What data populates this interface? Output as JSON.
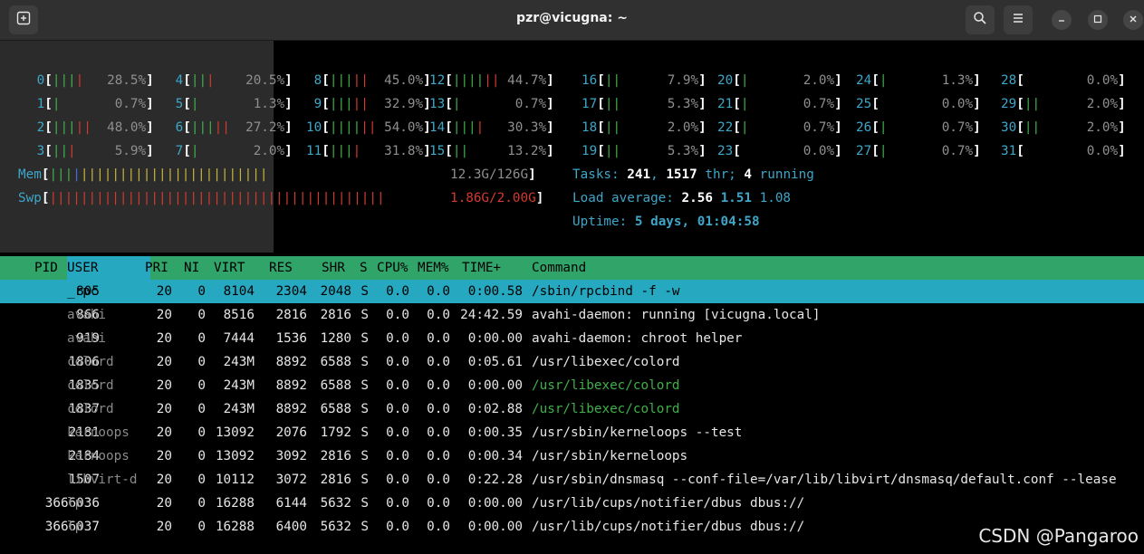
{
  "window": {
    "title": "pzr@vicugna: ~",
    "new_tab_icon": "new-tab-icon",
    "search_icon": "search-icon",
    "menu_icon": "hamburger-menu-icon",
    "minimize_icon": "minimize-icon",
    "maximize_icon": "maximize-icon",
    "close_icon": "close-icon"
  },
  "cpus": [
    {
      "id": "0",
      "bar": "||||",
      "pct": "28.5%"
    },
    {
      "id": "1",
      "bar": "|",
      "pct": "0.7%"
    },
    {
      "id": "2",
      "bar": "|||||",
      "pct": "48.0%"
    },
    {
      "id": "3",
      "bar": "|||",
      "pct": "5.9%"
    },
    {
      "id": "4",
      "bar": "|||",
      "pct": "20.5%"
    },
    {
      "id": "5",
      "bar": "|",
      "pct": "1.3%"
    },
    {
      "id": "6",
      "bar": "|||||",
      "pct": "27.2%"
    },
    {
      "id": "7",
      "bar": "|",
      "pct": "2.0%"
    },
    {
      "id": "8",
      "bar": "|||||",
      "pct": "45.0%"
    },
    {
      "id": "9",
      "bar": "|||||",
      "pct": "32.9%"
    },
    {
      "id": "10",
      "bar": "||||||",
      "pct": "54.0%"
    },
    {
      "id": "11",
      "bar": "||||",
      "pct": "31.8%"
    },
    {
      "id": "12",
      "bar": "||||||",
      "pct": "44.7%"
    },
    {
      "id": "13",
      "bar": "|",
      "pct": "0.7%"
    },
    {
      "id": "14",
      "bar": "||||",
      "pct": "30.3%"
    },
    {
      "id": "15",
      "bar": "||",
      "pct": "13.2%"
    },
    {
      "id": "16",
      "bar": "||",
      "pct": "7.9%"
    },
    {
      "id": "17",
      "bar": "||",
      "pct": "5.3%"
    },
    {
      "id": "18",
      "bar": "||",
      "pct": "2.0%"
    },
    {
      "id": "19",
      "bar": "||",
      "pct": "5.3%"
    },
    {
      "id": "20",
      "bar": "|",
      "pct": "2.0%"
    },
    {
      "id": "21",
      "bar": "|",
      "pct": "0.7%"
    },
    {
      "id": "22",
      "bar": "|",
      "pct": "0.7%"
    },
    {
      "id": "23",
      "bar": "",
      "pct": "0.0%"
    },
    {
      "id": "24",
      "bar": "|",
      "pct": "1.3%"
    },
    {
      "id": "25",
      "bar": "",
      "pct": "0.0%"
    },
    {
      "id": "26",
      "bar": "|",
      "pct": "0.7%"
    },
    {
      "id": "27",
      "bar": "|",
      "pct": "0.7%"
    },
    {
      "id": "28",
      "bar": "",
      "pct": "0.0%"
    },
    {
      "id": "29",
      "bar": "||",
      "pct": "2.0%"
    },
    {
      "id": "30",
      "bar": "||",
      "pct": "2.0%"
    },
    {
      "id": "31",
      "bar": "",
      "pct": "0.0%"
    }
  ],
  "mem": {
    "label": "Mem",
    "value": "12.3G/126G",
    "fill": 0.098
  },
  "swp": {
    "label": "Swp",
    "value": "1.86G/2.00G",
    "fill": 0.93
  },
  "tasks": {
    "label": "Tasks:",
    "count": "241",
    "thr": "1517",
    "thr_label": "thr;",
    "running": "4",
    "running_label": "running"
  },
  "load": {
    "label": "Load average:",
    "l1": "2.56",
    "l5": "1.51",
    "l15": "1.08"
  },
  "uptime": {
    "label": "Uptime:",
    "value": "5 days, 01:04:58"
  },
  "columns": [
    "PID",
    "USER",
    "PRI",
    "NI",
    "VIRT",
    "RES",
    "SHR",
    "S",
    "CPU%",
    "MEM%",
    "TIME+",
    "Command"
  ],
  "processes": [
    {
      "pid": "805",
      "user": "_rpc",
      "pri": "20",
      "ni": "0",
      "virt": "8104",
      "res": "2304",
      "shr": "2048",
      "s": "S",
      "cpu": "0.0",
      "mem": "0.0",
      "time": "0:00.58",
      "cmd": "/sbin/rpcbind -f -w"
    },
    {
      "pid": "866",
      "user": "avahi",
      "pri": "20",
      "ni": "0",
      "virt": "8516",
      "res": "2816",
      "shr": "2816",
      "s": "S",
      "cpu": "0.0",
      "mem": "0.0",
      "time": "24:42.59",
      "cmd": "avahi-daemon: running [vicugna.local]"
    },
    {
      "pid": "919",
      "user": "avahi",
      "pri": "20",
      "ni": "0",
      "virt": "7444",
      "res": "1536",
      "shr": "1280",
      "s": "S",
      "cpu": "0.0",
      "mem": "0.0",
      "time": "0:00.00",
      "cmd": "avahi-daemon: chroot helper"
    },
    {
      "pid": "1806",
      "user": "colord",
      "pri": "20",
      "ni": "0",
      "virt": "243M",
      "res": "8892",
      "shr": "6588",
      "s": "S",
      "cpu": "0.0",
      "mem": "0.0",
      "time": "0:05.61",
      "cmd": "/usr/libexec/colord"
    },
    {
      "pid": "1835",
      "user": "colord",
      "pri": "20",
      "ni": "0",
      "virt": "243M",
      "res": "8892",
      "shr": "6588",
      "s": "S",
      "cpu": "0.0",
      "mem": "0.0",
      "time": "0:00.00",
      "cmd": "/usr/libexec/colord"
    },
    {
      "pid": "1837",
      "user": "colord",
      "pri": "20",
      "ni": "0",
      "virt": "243M",
      "res": "8892",
      "shr": "6588",
      "s": "S",
      "cpu": "0.0",
      "mem": "0.0",
      "time": "0:02.88",
      "cmd": "/usr/libexec/colord"
    },
    {
      "pid": "2181",
      "user": "kernoops",
      "pri": "20",
      "ni": "0",
      "virt": "13092",
      "res": "2076",
      "shr": "1792",
      "s": "S",
      "cpu": "0.0",
      "mem": "0.0",
      "time": "0:00.35",
      "cmd": "/usr/sbin/kerneloops --test"
    },
    {
      "pid": "2184",
      "user": "kernoops",
      "pri": "20",
      "ni": "0",
      "virt": "13092",
      "res": "3092",
      "shr": "2816",
      "s": "S",
      "cpu": "0.0",
      "mem": "0.0",
      "time": "0:00.34",
      "cmd": "/usr/sbin/kerneloops"
    },
    {
      "pid": "1507",
      "user": "libvirt-d",
      "pri": "20",
      "ni": "0",
      "virt": "10112",
      "res": "3072",
      "shr": "2816",
      "s": "S",
      "cpu": "0.0",
      "mem": "0.0",
      "time": "0:22.28",
      "cmd": "/usr/sbin/dnsmasq --conf-file=/var/lib/libvirt/dnsmasq/default.conf --lease"
    },
    {
      "pid": "3666036",
      "user": "lp",
      "pri": "20",
      "ni": "0",
      "virt": "16288",
      "res": "6144",
      "shr": "5632",
      "s": "S",
      "cpu": "0.0",
      "mem": "0.0",
      "time": "0:00.00",
      "cmd": "/usr/lib/cups/notifier/dbus dbus://"
    },
    {
      "pid": "3666037",
      "user": "lp",
      "pri": "20",
      "ni": "0",
      "virt": "16288",
      "res": "6400",
      "shr": "5632",
      "s": "S",
      "cpu": "0.0",
      "mem": "0.0",
      "time": "0:00.00",
      "cmd": "/usr/lib/cups/notifier/dbus dbus://"
    }
  ],
  "watermark": "CSDN @Pangaroo"
}
